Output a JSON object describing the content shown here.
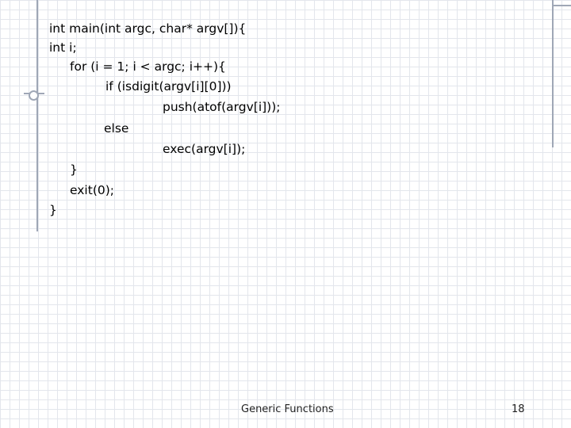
{
  "code_lines": [
    "int main(int argc, char* argv[]){",
    "int i;",
    "for (i = 1; i < argc; i++){",
    "if (isdigit(argv[i][0]))",
    "push(atof(argv[i]));",
    "else",
    "exec(argv[i]);",
    "}",
    "exit(0);",
    "}"
  ],
  "footer": {
    "title": "Generic Functions",
    "page_number": "18"
  },
  "colors": {
    "grid": "#e3e6ec",
    "decoration": "#9fa7b6",
    "text": "#000000"
  }
}
